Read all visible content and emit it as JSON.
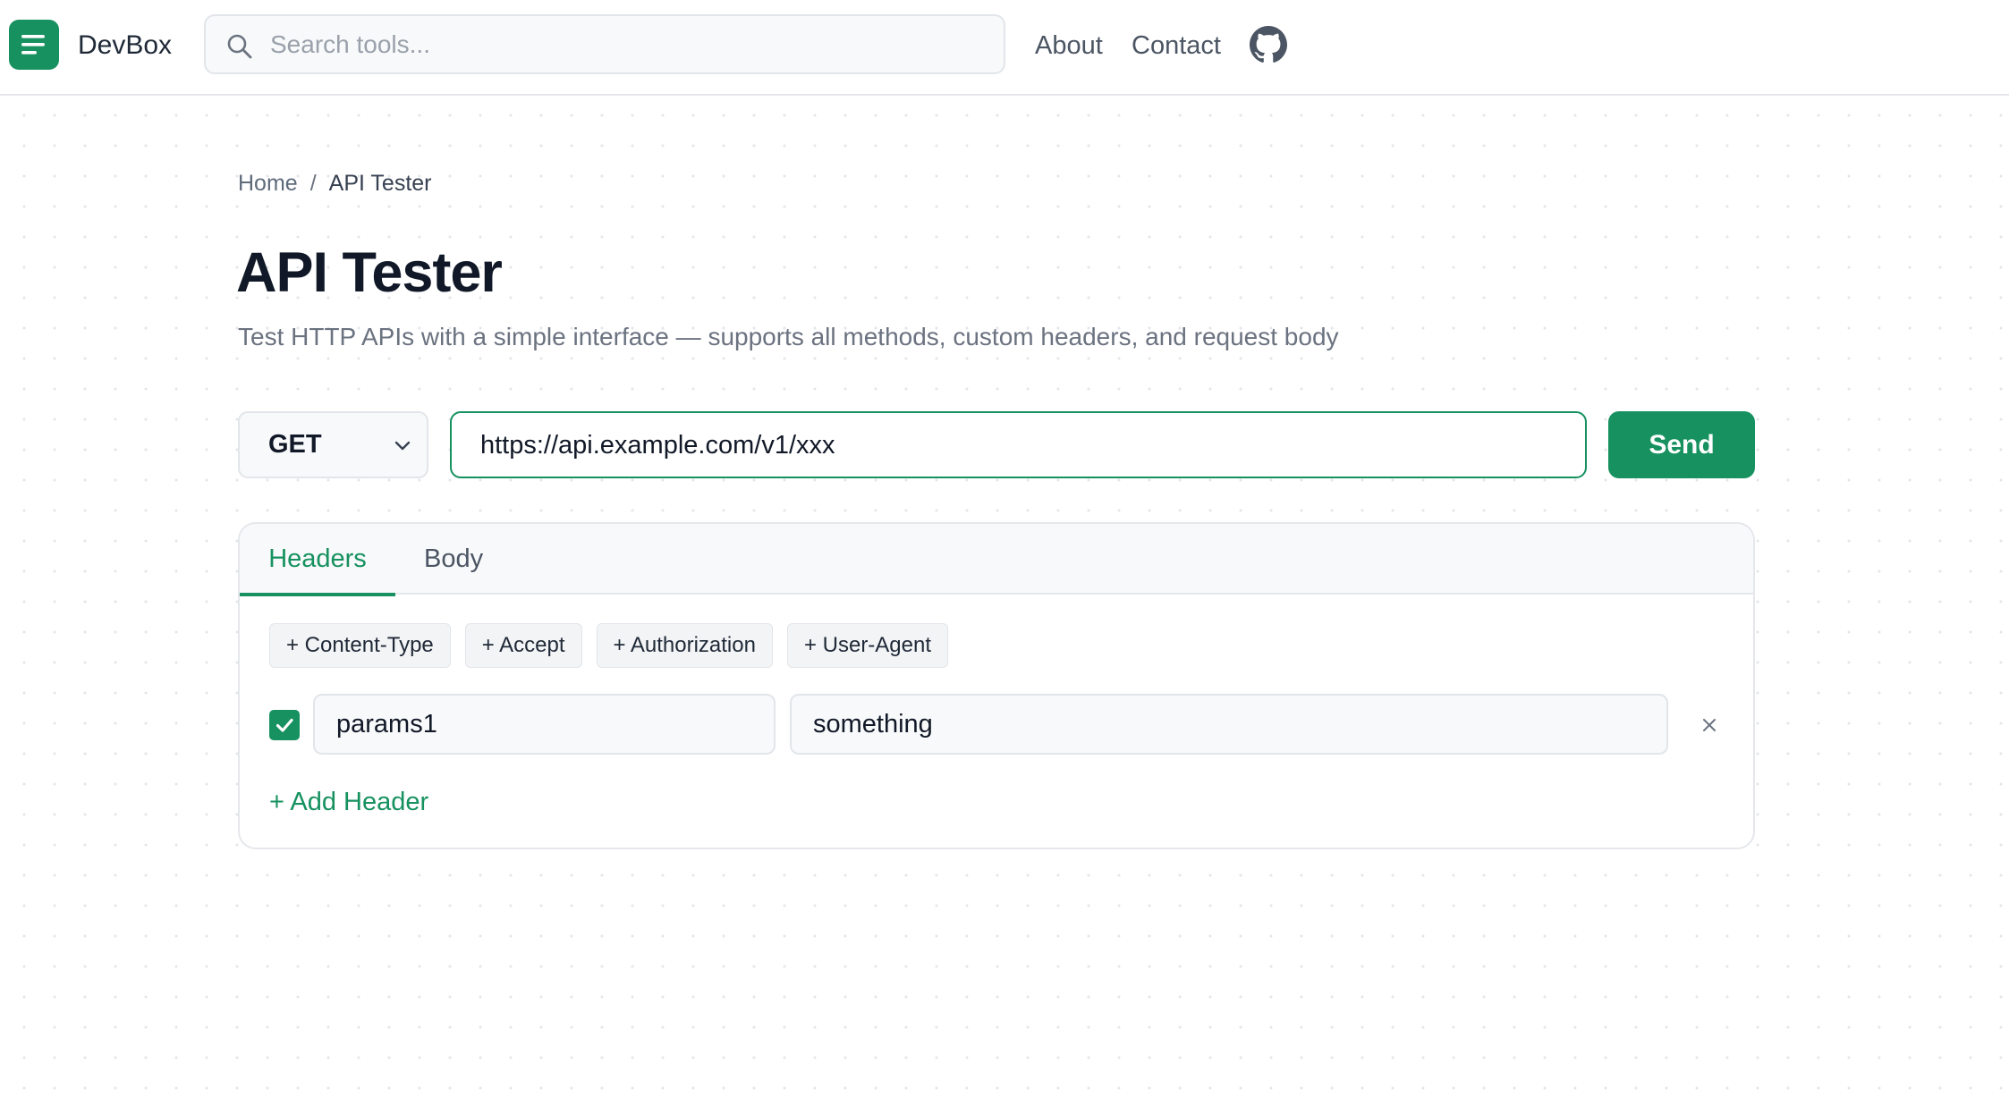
{
  "app": {
    "brand": "DevBox",
    "accent_color": "#16915f"
  },
  "header": {
    "search_placeholder": "Search tools...",
    "nav": {
      "about": "About",
      "contact": "Contact"
    }
  },
  "breadcrumb": {
    "home": "Home",
    "separator": "/",
    "current": "API Tester"
  },
  "page": {
    "title": "API Tester",
    "subtitle": "Test HTTP APIs with a simple interface — supports all methods, custom headers, and request body"
  },
  "request": {
    "method": "GET",
    "url": "https://api.example.com/v1/xxx",
    "send_label": "Send"
  },
  "tabs": {
    "headers": "Headers",
    "body": "Body",
    "active": "Headers"
  },
  "presets": [
    "+ Content-Type",
    "+ Accept",
    "+ Authorization",
    "+ User-Agent"
  ],
  "headers": {
    "rows": [
      {
        "enabled": true,
        "key": "params1",
        "value": "something"
      }
    ],
    "remove_label": "×",
    "add_label": "+ Add Header"
  }
}
